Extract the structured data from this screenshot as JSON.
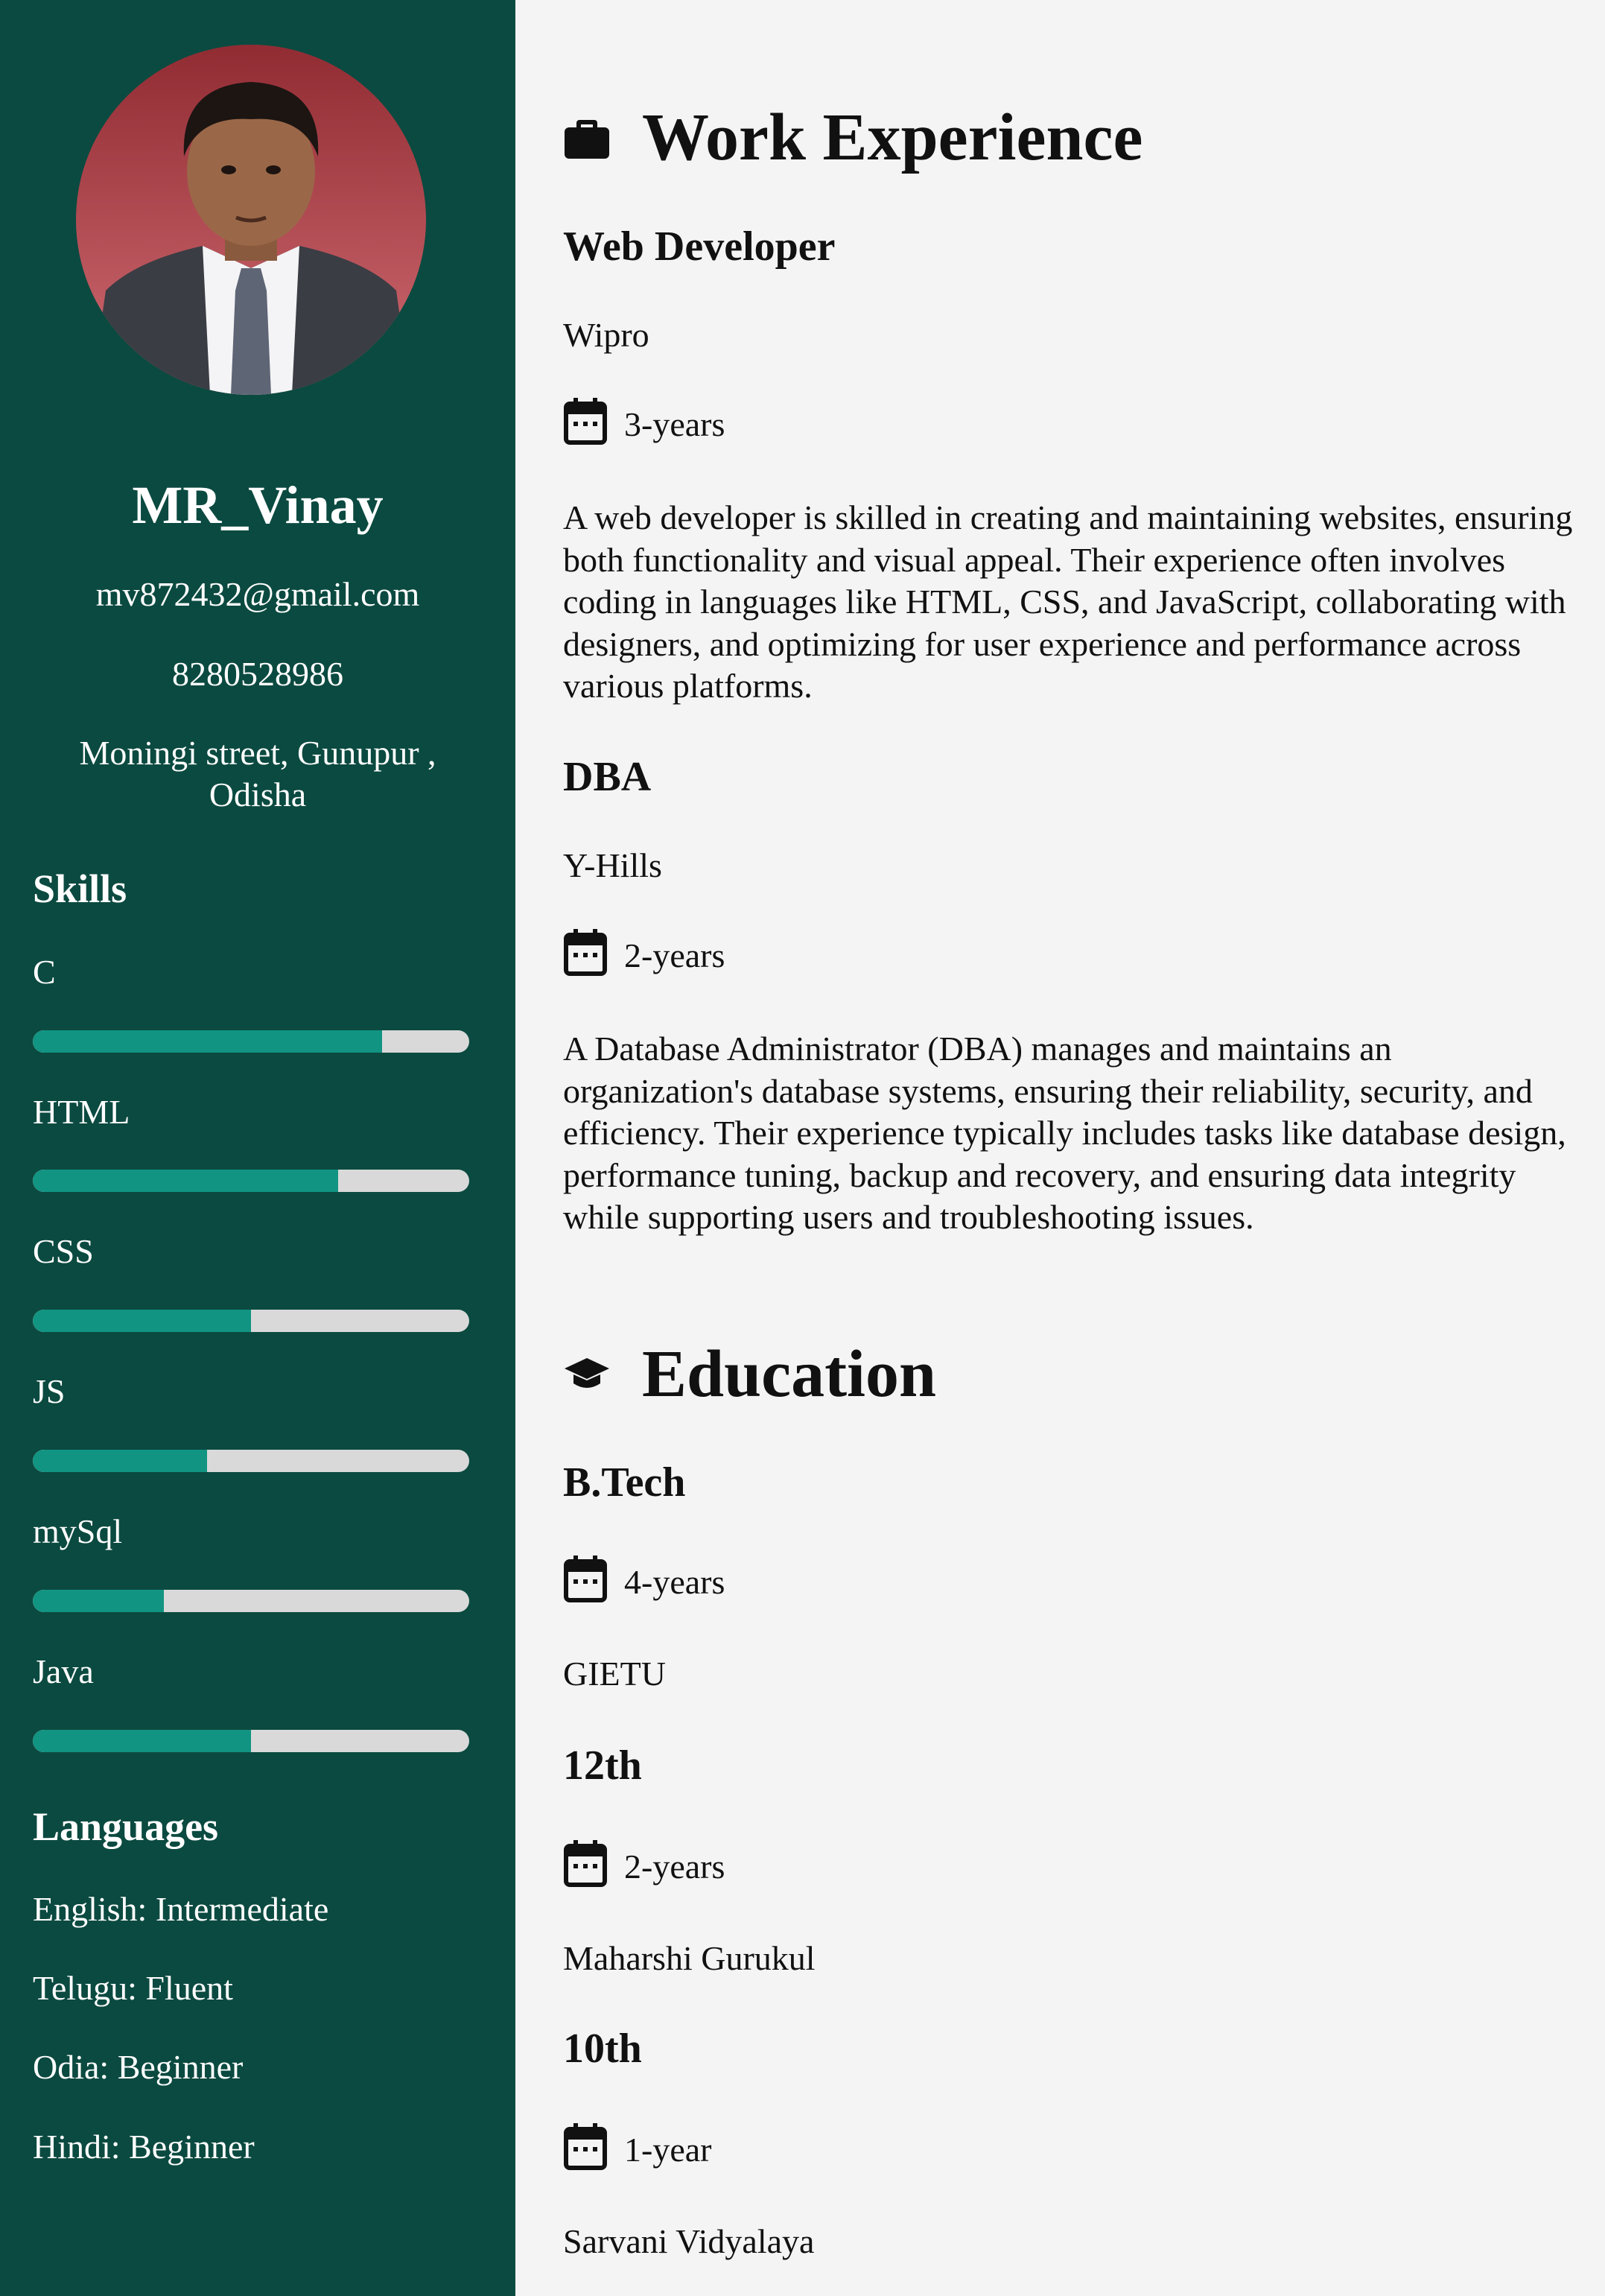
{
  "profile": {
    "name": "MR_Vinay",
    "email": "mv872432@gmail.com",
    "phone": "8280528986",
    "address": "Moningi street, Gunupur , Odisha"
  },
  "skills": {
    "heading": "Skills",
    "items": [
      {
        "label": "C",
        "level": 0.8
      },
      {
        "label": "HTML",
        "level": 0.7
      },
      {
        "label": "CSS",
        "level": 0.5
      },
      {
        "label": "JS",
        "level": 0.4
      },
      {
        "label": "mySql",
        "level": 0.3
      },
      {
        "label": "Java",
        "level": 0.5
      }
    ]
  },
  "languages": {
    "heading": "Languages",
    "items": [
      "English: Intermediate",
      "Telugu: Fluent",
      "Odia: Beginner",
      "Hindi: Beginner"
    ]
  },
  "work": {
    "heading": "Work Experience",
    "icon": "briefcase-icon",
    "jobs": [
      {
        "title": "Web Developer",
        "company": "Wipro",
        "duration": "3-years",
        "description": "A web developer is skilled in creating and maintaining websites, ensuring both functionality and visual appeal. Their experience often involves coding in languages like HTML, CSS, and JavaScript, collaborating with designers, and optimizing for user experience and performance across various platforms."
      },
      {
        "title": "DBA",
        "company": "Y-Hills",
        "duration": "2-years",
        "description": "A Database Administrator (DBA) manages and maintains an organization's database systems, ensuring their reliability, security, and efficiency. Their experience typically includes tasks like database design, performance tuning, backup and recovery, and ensuring data integrity while supporting users and troubleshooting issues."
      }
    ]
  },
  "education": {
    "heading": "Education",
    "icon": "graduation-cap-icon",
    "items": [
      {
        "degree": "B.Tech",
        "duration": "4-years",
        "institution": "GIETU"
      },
      {
        "degree": "12th",
        "duration": "2-years",
        "institution": "Maharshi Gurukul"
      },
      {
        "degree": "10th",
        "duration": "1-year",
        "institution": "Sarvani Vidyalaya"
      }
    ]
  },
  "colors": {
    "sidebar": "#0b4a40",
    "accent": "#119482",
    "bar_track": "#d9d9d9",
    "main_bg": "#f4f4f4"
  }
}
